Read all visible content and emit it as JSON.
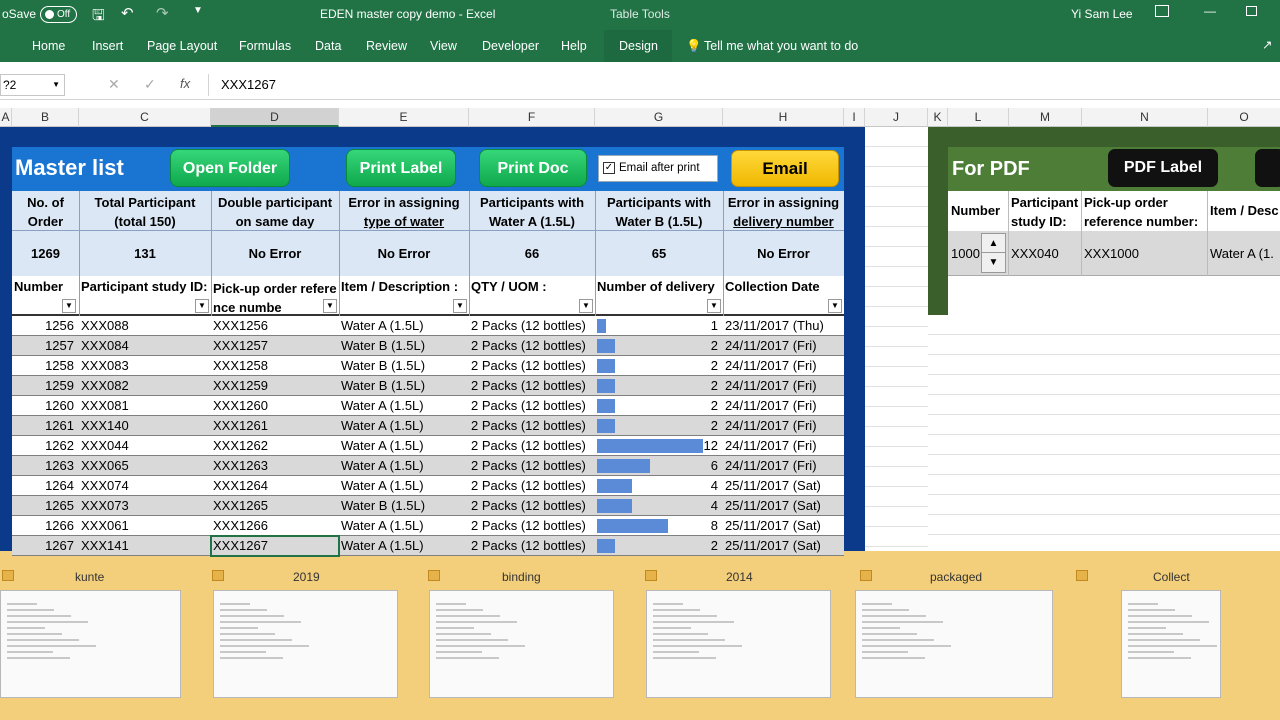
{
  "titlebar": {
    "autosave": "oSave",
    "autosave_state": "Off",
    "title": "EDEN master copy demo  -  Excel",
    "table_tools": "Table Tools",
    "user": "Yi Sam Lee"
  },
  "ribbon": {
    "tabs": [
      "Home",
      "Insert",
      "Page Layout",
      "Formulas",
      "Data",
      "Review",
      "View",
      "Developer",
      "Help",
      "Design"
    ],
    "tell_me": "Tell me what you want to do"
  },
  "formula_bar": {
    "name_box": "?2",
    "fx": "fx",
    "value": "XXX1267"
  },
  "columns": [
    "A",
    "B",
    "C",
    "D",
    "E",
    "F",
    "G",
    "H",
    "I",
    "J",
    "K",
    "L",
    "M",
    "N",
    "O"
  ],
  "master": {
    "title": "Master list",
    "open_folder": "Open Folder",
    "print_label": "Print Label",
    "print_doc": "Print Doc",
    "email_after_print": "Email after print",
    "email": "Email",
    "summary_headers": [
      [
        "No. of",
        "Order"
      ],
      [
        "Total Participant",
        "(total 150)"
      ],
      [
        "Double participant",
        "on same day"
      ],
      [
        "Error in assigning",
        "type of water"
      ],
      [
        "Participants with",
        "Water A (1.5L)"
      ],
      [
        "Participants with",
        "Water B (1.5L)"
      ],
      [
        "Error in assigning",
        "delivery number"
      ]
    ],
    "summary_values": [
      "1269",
      "131",
      "No Error",
      "No Error",
      "66",
      "65",
      "No Error"
    ],
    "table_headers": [
      "Number",
      "Participant study ID:",
      "Pick-up order reference numbe",
      "Item / Description :",
      "QTY / UOM :",
      "Number of delivery",
      "Collection Date"
    ],
    "rows": [
      [
        "1256",
        "XXX088",
        "XXX1256",
        "Water A (1.5L)",
        "2 Packs (12 bottles)",
        "1",
        "23/11/2017  (Thu)"
      ],
      [
        "1257",
        "XXX084",
        "XXX1257",
        "Water B (1.5L)",
        "2 Packs (12 bottles)",
        "2",
        "24/11/2017  (Fri)"
      ],
      [
        "1258",
        "XXX083",
        "XXX1258",
        "Water B (1.5L)",
        "2 Packs (12 bottles)",
        "2",
        "24/11/2017  (Fri)"
      ],
      [
        "1259",
        "XXX082",
        "XXX1259",
        "Water B (1.5L)",
        "2 Packs (12 bottles)",
        "2",
        "24/11/2017  (Fri)"
      ],
      [
        "1260",
        "XXX081",
        "XXX1260",
        "Water A (1.5L)",
        "2 Packs (12 bottles)",
        "2",
        "24/11/2017  (Fri)"
      ],
      [
        "1261",
        "XXX140",
        "XXX1261",
        "Water A (1.5L)",
        "2 Packs (12 bottles)",
        "2",
        "24/11/2017  (Fri)"
      ],
      [
        "1262",
        "XXX044",
        "XXX1262",
        "Water A (1.5L)",
        "2 Packs (12 bottles)",
        "12",
        "24/11/2017  (Fri)"
      ],
      [
        "1263",
        "XXX065",
        "XXX1263",
        "Water A (1.5L)",
        "2 Packs (12 bottles)",
        "6",
        "24/11/2017  (Fri)"
      ],
      [
        "1264",
        "XXX074",
        "XXX1264",
        "Water A (1.5L)",
        "2 Packs (12 bottles)",
        "4",
        "25/11/2017  (Sat)"
      ],
      [
        "1265",
        "XXX073",
        "XXX1265",
        "Water B (1.5L)",
        "2 Packs (12 bottles)",
        "4",
        "25/11/2017  (Sat)"
      ],
      [
        "1266",
        "XXX061",
        "XXX1266",
        "Water A (1.5L)",
        "2 Packs (12 bottles)",
        "8",
        "25/11/2017  (Sat)"
      ],
      [
        "1267",
        "XXX141",
        "XXX1267",
        "Water A (1.5L)",
        "2 Packs (12 bottles)",
        "2",
        "25/11/2017  (Sat)"
      ]
    ]
  },
  "pdf": {
    "title": "For PDF",
    "pdf_label": "PDF Label",
    "headers": [
      "Number",
      "Participant study ID:",
      "Pick-up order reference number:",
      "Item / Desc"
    ],
    "values": [
      "1000",
      "XXX040",
      "XXX1000",
      "Water A (1."
    ]
  },
  "taskbar": {
    "windows": [
      "kunte",
      "2019",
      "binding",
      "2014",
      "packaged",
      "Collect"
    ]
  },
  "colors": {
    "excel_green": "#217346",
    "master_blue": "#1a75d2",
    "green_button": "#10a84c",
    "email_yellow": "#f5c400",
    "pdf_green": "#3a5f2a",
    "taskbar": "#f3cf7b"
  }
}
